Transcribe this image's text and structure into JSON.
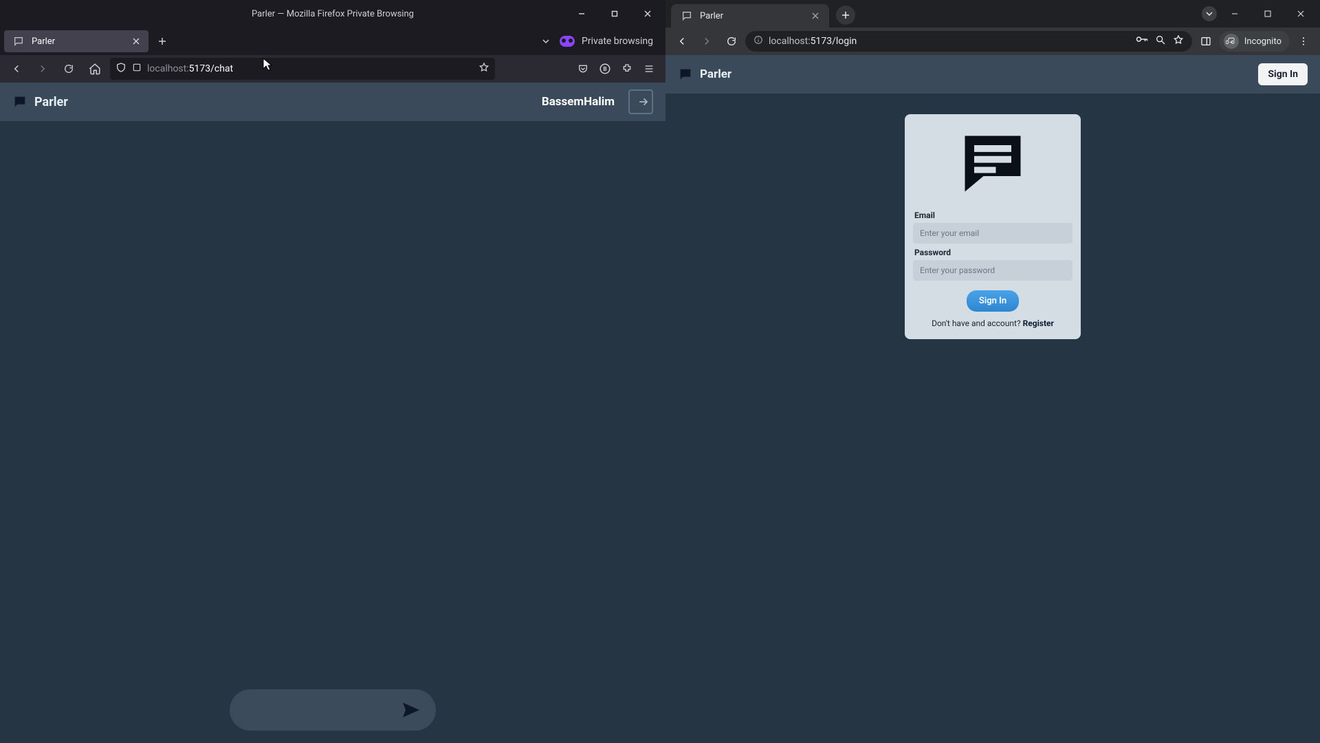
{
  "firefox": {
    "title": "Parler — Mozilla Firefox Private Browsing",
    "tab_name": "Parler",
    "private_label": "Private browsing",
    "url_host": "localhost:",
    "url_rest": "5173/chat",
    "app": {
      "brand": "Parler",
      "username": "BassemHalim",
      "message_placeholder": ""
    }
  },
  "chrome": {
    "tab_name": "Parler",
    "url_host": "localhost:",
    "url_rest": "5173/login",
    "incognito_label": "Incognito",
    "app": {
      "brand": "Parler",
      "signin_header_btn": "Sign In",
      "login": {
        "email_label": "Email",
        "email_placeholder": "Enter your email",
        "password_label": "Password",
        "password_placeholder": "Enter your password",
        "submit": "Sign In",
        "register_prompt": "Don't have and account? ",
        "register_link": "Register"
      }
    }
  }
}
